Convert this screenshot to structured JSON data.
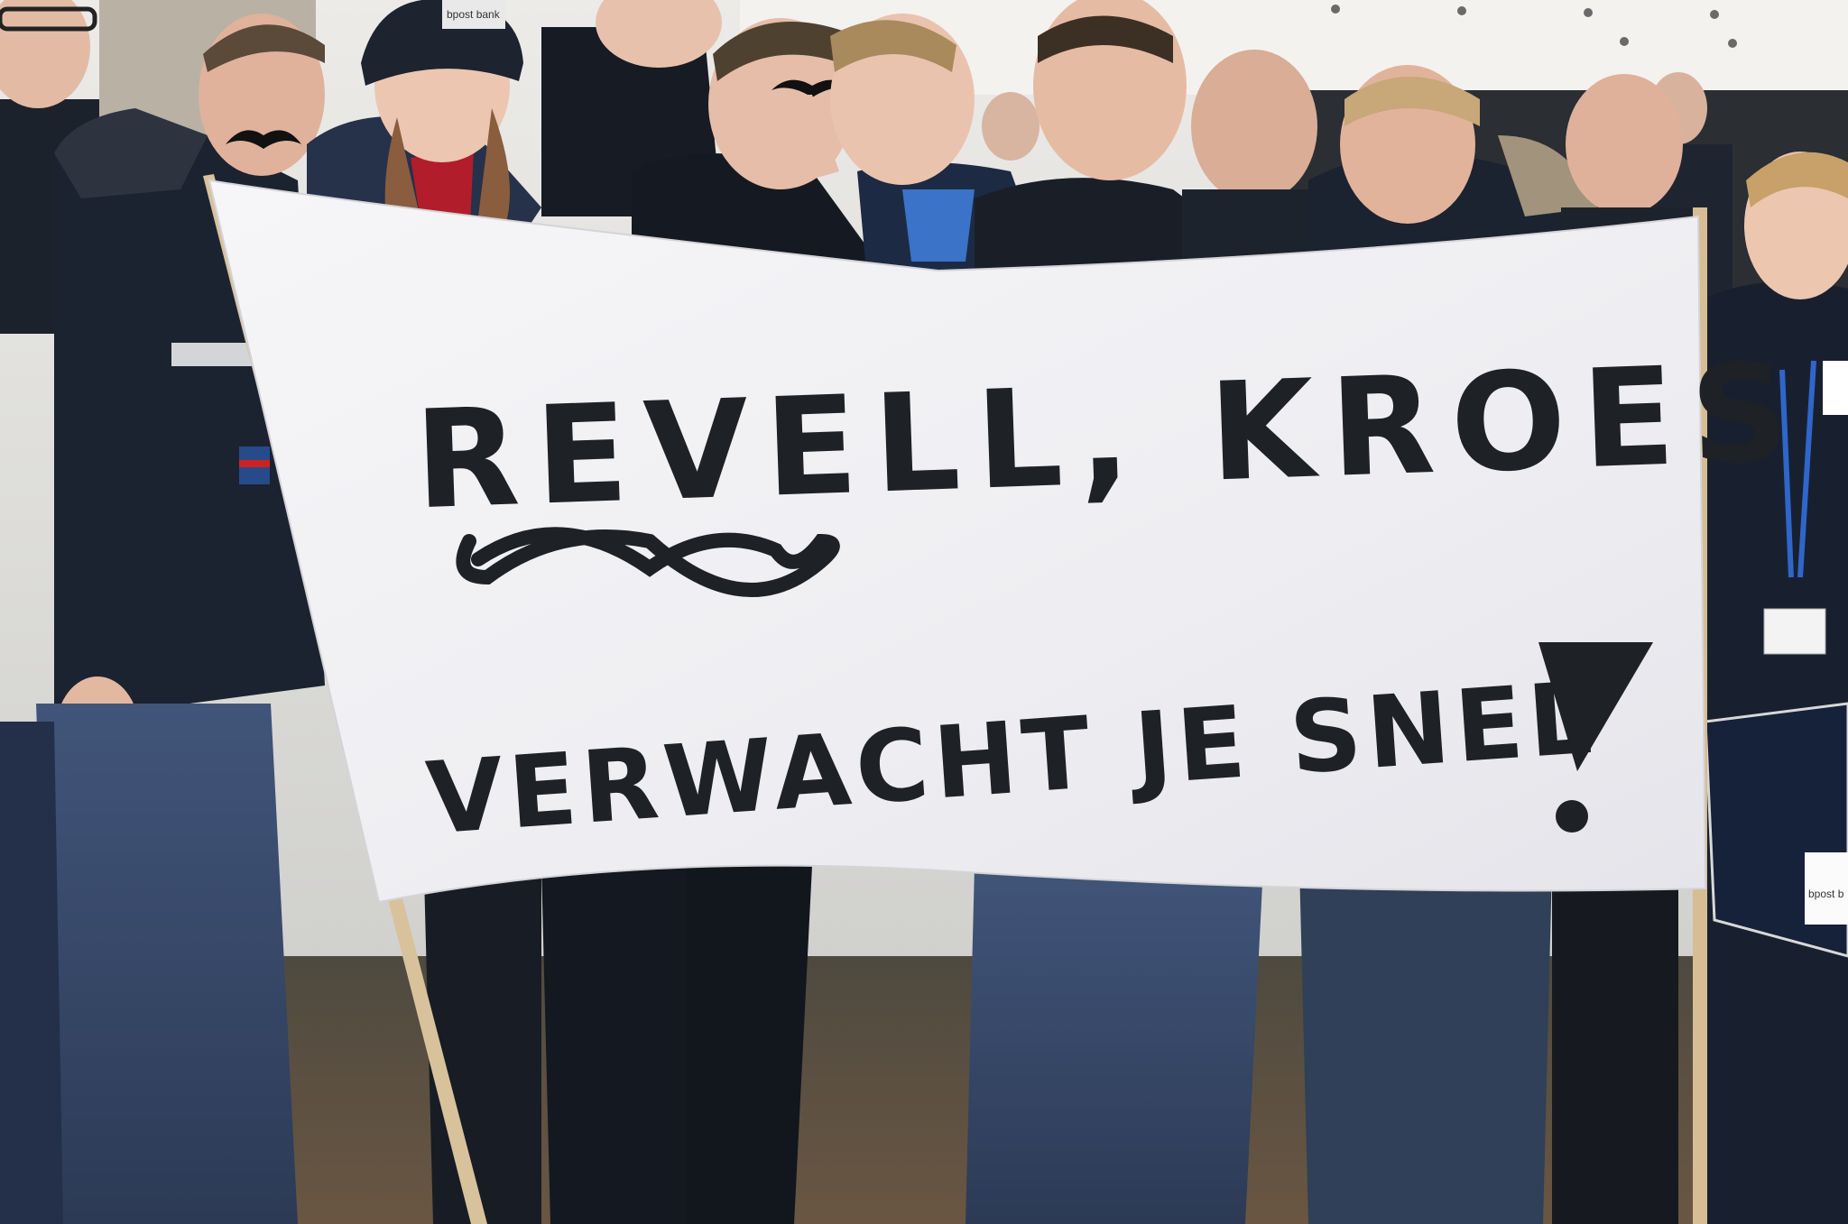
{
  "photo": {
    "description_kind": "crowd holding protest banner outdoors",
    "colors": {
      "sky": "#e7e7e4",
      "tent": "#f2f1ee",
      "ground": "#5a4a3a",
      "banner": "#f4f4f6",
      "ink": "#1e2126",
      "jacket_dark": "#1c2430",
      "jeans": "#3b4e6b",
      "skin": "#e2b9a2",
      "pole": "#d9c19a"
    }
  },
  "banner": {
    "line1": "REVELL, KROES",
    "line2": "VERWACHT JE SNEL",
    "exclamation": "!"
  },
  "props": {
    "beanie_tag": "bpost bank",
    "bag_tag": "bpost b"
  }
}
